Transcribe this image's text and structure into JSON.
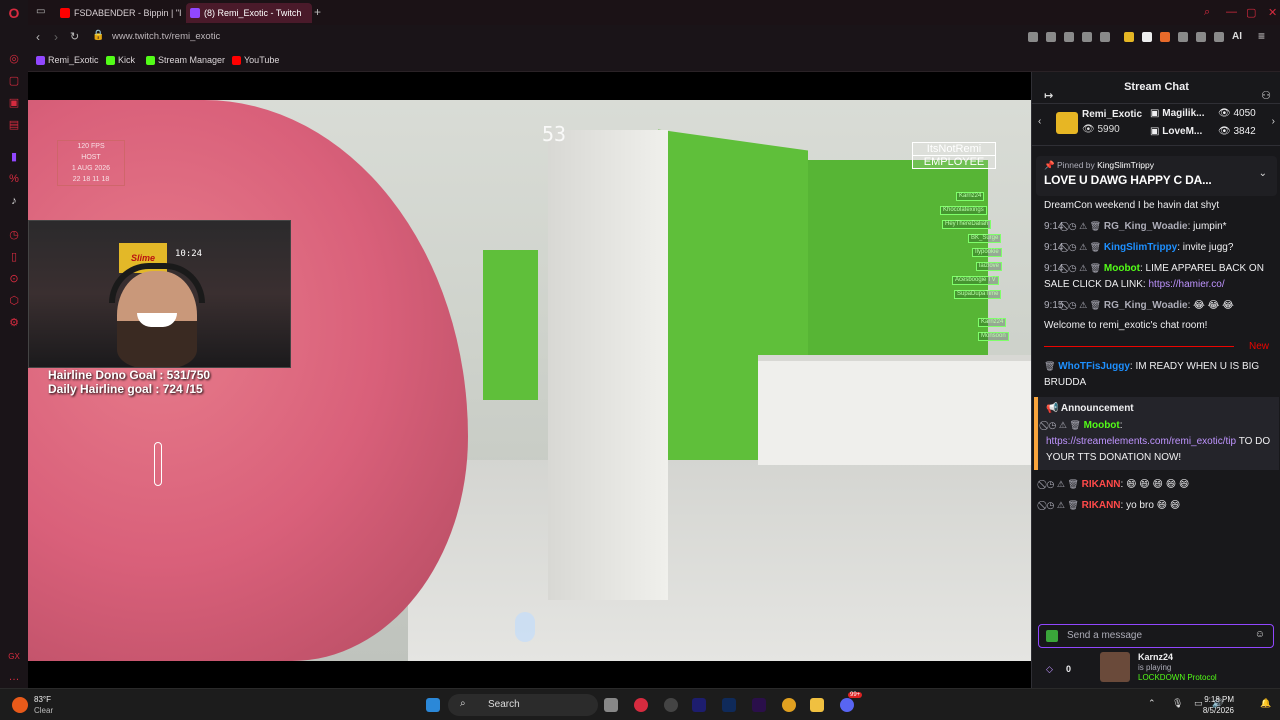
{
  "browser": {
    "tabs": [
      {
        "label": "FSDABENDER - Bippin | \"In",
        "active": false
      },
      {
        "label": "(8) Remi_Exotic - Twitch",
        "active": true
      }
    ],
    "url": "www.twitch.tv/remi_exotic",
    "bookmarks": [
      {
        "label": "Remi_Exotic",
        "color": "#9147ff"
      },
      {
        "label": "Kick",
        "color": "#53fc18"
      },
      {
        "label": "Stream Manager",
        "color": "#53fc18"
      },
      {
        "label": "YouTube",
        "color": "#ff0000"
      }
    ],
    "ai_label": "AI"
  },
  "stream": {
    "hud_number": "53",
    "fps_overlay": [
      "120 FPS",
      "HOST",
      "1 AUG 2026",
      "22 18 11 18"
    ],
    "name_badge": [
      "ItsNotRemi",
      "EMPLOYEE"
    ],
    "player_tags": [
      "Karnz24",
      "Khocolatexings",
      "HeyThereDaliah",
      "BK_Surge",
      "Ilypookie",
      "laizlove",
      "Acesboogie TV",
      "SupaDupaTime",
      "Karnz24",
      "Monsoon"
    ],
    "cam_sign": "Slime",
    "cam_clock": "10:24",
    "hairline_goal": "Hairline Dono Goal : 531/750",
    "daily_goal": "Daily Hairline goal : 724 /15"
  },
  "chat": {
    "title": "Stream Chat",
    "leaderboard": {
      "top": {
        "name": "Remi_Exotic",
        "views": "5990"
      },
      "others": [
        {
          "name": "Magilik...",
          "views": "4050"
        },
        {
          "name": "LoveM...",
          "views": "3842"
        }
      ]
    },
    "pinned": {
      "by_prefix": "Pinned by",
      "by": "KingSlimTrippy",
      "message": "LOVE U DAWG HAPPY C DA..."
    },
    "messages": [
      {
        "time": "",
        "user": "",
        "color": "#efeff1",
        "text": "DreamCon weekend I be havin dat shyt"
      },
      {
        "time": "9:14",
        "user": "RG_King_Woadie",
        "color": "#adadb8",
        "text": "jumpin*"
      },
      {
        "time": "9:14",
        "user": "KingSlimTrippy",
        "color": "#1e90ff",
        "text": "invite jugg?"
      },
      {
        "time": "9:14",
        "user": "Moobot",
        "color": "#53fc18",
        "text": "LIME APPAREL BACK ON SALE CLICK DA LINK:",
        "link": "https://hamier.co/"
      },
      {
        "time": "9:15",
        "user": "RG_King_Woadie",
        "color": "#adadb8",
        "text": "😂 😂 😂"
      }
    ],
    "welcome": "Welcome to remi_exotic's chat room!",
    "new_label": "New",
    "after_new": [
      {
        "user": "WhoTFisJuggy",
        "color": "#1e90ff",
        "text": "IM READY WHEN U IS BIG BRUDDA"
      }
    ],
    "announcement": {
      "header": "Announcement",
      "user": "Moobot",
      "link": "https://streamelements.com/remi_exotic/tip",
      "text": "TO DO YOUR TTS DONATION NOW!"
    },
    "tail": [
      {
        "user": "RIKANN",
        "color": "#ff4a4a",
        "text": "😄 😄 😄 😄 😄"
      },
      {
        "user": "RIKANN",
        "color": "#ff4a4a",
        "text": "yo bro 😄 😄"
      }
    ],
    "input_placeholder": "Send a message",
    "footer": {
      "points": "0",
      "viewer": "Karnz24",
      "status": "is playing",
      "game": "LOCKDOWN Protocol"
    }
  },
  "taskbar": {
    "weather_temp": "83°F",
    "weather_desc": "Clear",
    "search": "Search",
    "time": "9:18 PM",
    "date": "8/5/2026",
    "notif_count": "99+"
  }
}
